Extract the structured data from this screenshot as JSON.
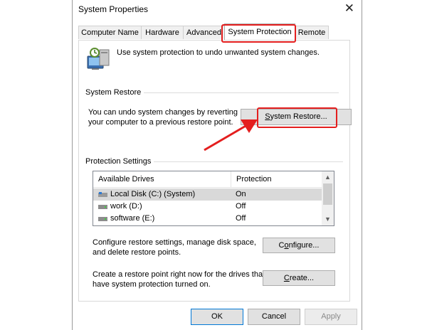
{
  "window": {
    "title": "System Properties"
  },
  "tabs": [
    {
      "label": "Computer Name"
    },
    {
      "label": "Hardware"
    },
    {
      "label": "Advanced"
    },
    {
      "label": "System Protection"
    },
    {
      "label": "Remote"
    }
  ],
  "intro_text": "Use system protection to undo unwanted system changes.",
  "system_restore": {
    "group_title": "System Restore",
    "description_line1": "You can undo system changes by reverting",
    "description_line2": "your computer to a previous restore point.",
    "button_pre": "",
    "button_mnemonic": "S",
    "button_post": "ystem Restore..."
  },
  "protection": {
    "group_title": "Protection Settings",
    "columns": [
      "Available Drives",
      "Protection"
    ],
    "rows": [
      {
        "drive": "Local Disk (C:) (System)",
        "protection": "On"
      },
      {
        "drive": "work (D:)",
        "protection": "Off"
      },
      {
        "drive": "software (E:)",
        "protection": "Off"
      }
    ],
    "configure_text_line1": "Configure restore settings, manage disk space,",
    "configure_text_line2": "and delete restore points.",
    "configure_pre": "C",
    "configure_mnemonic": "o",
    "configure_post": "nfigure...",
    "create_text_line1": "Create a restore point right now for the drives that",
    "create_text_line2": "have system protection turned on.",
    "create_pre": "",
    "create_mnemonic": "C",
    "create_post": "reate..."
  },
  "footer": {
    "ok": "OK",
    "cancel": "Cancel",
    "apply": "Apply"
  },
  "colors": {
    "highlight": "#e41e1e",
    "button_face": "#e1e1e1",
    "selected_row": "#d9d9d9"
  }
}
